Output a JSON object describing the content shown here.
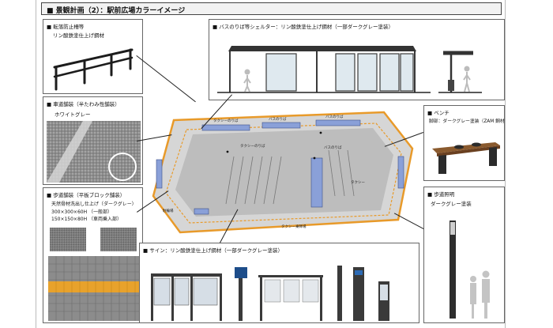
{
  "title": "■ 景観計画（2）：駅前広場カラーイメージ",
  "panels": {
    "railing": {
      "title": "■ 転落防止柵等",
      "note": "リン酸鉄塗仕上げ鋼材"
    },
    "paving": {
      "title": "■ 車道舗装（半たわみ性舗装）",
      "note": "ホワイトグレー"
    },
    "sidewalk": {
      "title": "■ 歩道舗装（平板ブロック舗装）",
      "note1": "天然骨材洗出し仕上げ（ダークグレー）",
      "note2": "300×300×60H （一般部）",
      "note3": "150×150×80H （車両乗入部）"
    },
    "shelter": {
      "title": "■ バスのりば等シェルター：リン酸鉄塗仕上げ鋼材（一部ダークグレー塗装）"
    },
    "bench": {
      "title": "■ ベンチ",
      "note": "脚部：ダークグレー塗装（ZAM 鋼材）"
    },
    "light": {
      "title": "■ 歩道照明",
      "note": "ダークグレー塗装"
    },
    "sign": {
      "title": "■ サイン：リン酸鉄塗仕上げ鋼材（一部ダークグレー塗装）"
    }
  },
  "plan_labels": [
    "タクシーのりば",
    "バスのりば",
    "バスのりば",
    "タクシーのりば",
    "バスのりば",
    "駐輪場",
    "タクシー",
    "タクシー乗降場"
  ],
  "colors": {
    "accent_orange": "#e89a2a",
    "shelter_blue": "#8aa0d8",
    "asphalt": "#bdbdbd",
    "dark_gray": "#3a3a3a"
  }
}
